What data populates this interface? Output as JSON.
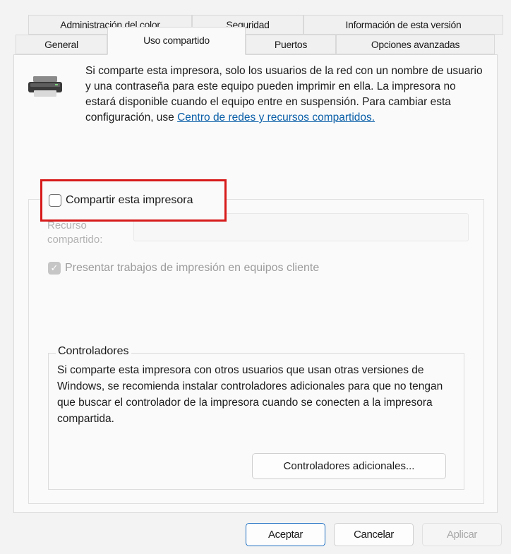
{
  "tabs": {
    "row1": [
      {
        "label": "Administración del color"
      },
      {
        "label": "Seguridad"
      },
      {
        "label": "Información de esta versión"
      }
    ],
    "row2": [
      {
        "label": "General"
      },
      {
        "label": "Uso compartido",
        "active": true
      },
      {
        "label": "Puertos"
      },
      {
        "label": "Opciones avanzadas"
      }
    ]
  },
  "intro": {
    "text": "Si comparte esta impresora, solo los usuarios de la red con un nombre de usuario y una contraseña para este equipo pueden imprimir en ella. La impresora no estará disponible cuando el equipo entre en suspensión. Para cambiar esta configuración, use ",
    "link": "Centro de redes y recursos compartidos."
  },
  "share": {
    "checkbox_label": "Compartir esta impresora",
    "checked": false,
    "resource_label": "Recurso compartido:",
    "resource_value": "",
    "render_label": "Presentar trabajos de impresión en equipos cliente",
    "render_checked": true
  },
  "drivers": {
    "title": "Controladores",
    "text": "Si comparte esta impresora con otros usuarios que usan otras versiones de Windows, se recomienda instalar controladores adicionales para que no tengan que buscar el controlador de la impresora cuando se conecten a la impresora compartida.",
    "button": "Controladores adicionales..."
  },
  "footer": {
    "ok": "Aceptar",
    "cancel": "Cancelar",
    "apply": "Aplicar"
  },
  "colors": {
    "highlight": "#d71a1a",
    "link": "#0a5fa8",
    "focus_border": "#1e6fc1"
  }
}
